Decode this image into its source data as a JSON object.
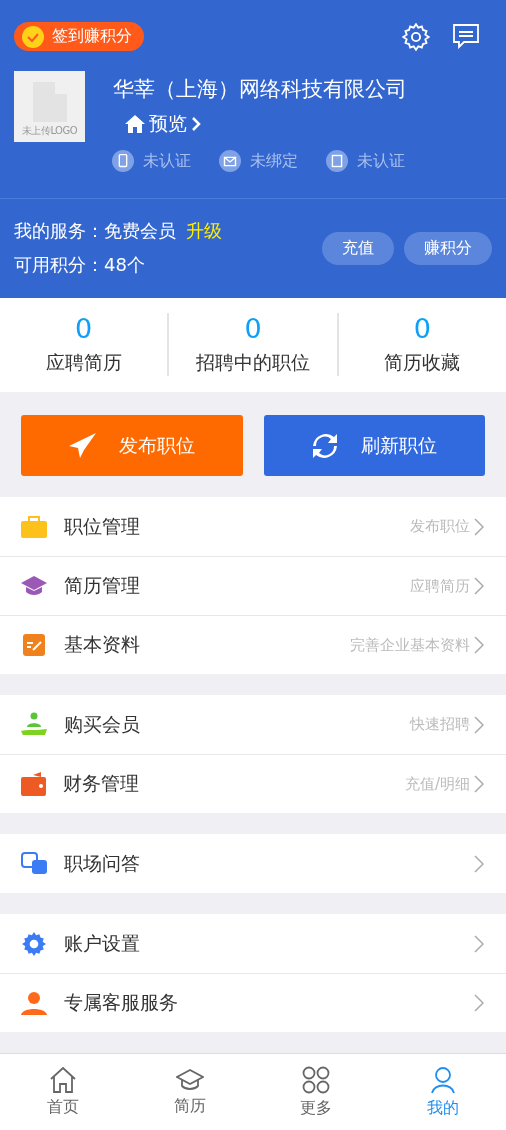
{
  "header": {
    "checkin_badge": "签到赚积分",
    "company_name": "华莘（上海）网络科技有限公司",
    "logo_caption": "未上传LOGO",
    "preview_link": "预览",
    "verifications": [
      {
        "kind": "phone",
        "label": "未认证"
      },
      {
        "kind": "mail",
        "label": "未绑定"
      },
      {
        "kind": "shop",
        "label": "未认证"
      }
    ],
    "service_label": "我的服务：免费会员",
    "upgrade_link": "升级",
    "points_label": "可用积分：48个",
    "buttons": [
      "充值",
      "赚积分"
    ]
  },
  "stats": [
    {
      "value": "0",
      "label": "应聘简历"
    },
    {
      "value": "0",
      "label": "招聘中的职位"
    },
    {
      "value": "0",
      "label": "简历收藏"
    }
  ],
  "actions": [
    {
      "kind": "publish",
      "label": "发布职位"
    },
    {
      "kind": "refresh",
      "label": "刷新职位"
    }
  ],
  "menu_groups": [
    [
      {
        "kind": "briefcase",
        "label": "职位管理",
        "hint": "发布职位"
      },
      {
        "kind": "cap",
        "label": "简历管理",
        "hint": "应聘简历"
      },
      {
        "kind": "edit",
        "label": "基本资料",
        "hint": "完善企业基本资料"
      }
    ],
    [
      {
        "kind": "member",
        "label": "购买会员",
        "hint": "快速招聘"
      },
      {
        "kind": "wallet",
        "label": "财务管理",
        "hint": "充值/明细"
      }
    ],
    [
      {
        "kind": "qa",
        "label": "职场问答"
      }
    ],
    [
      {
        "kind": "gear",
        "label": "账户设置"
      },
      {
        "kind": "agent",
        "label": "专属客服服务"
      }
    ]
  ],
  "tab_bar": [
    {
      "kind": "home",
      "label": "首页",
      "selected": false
    },
    {
      "kind": "cap",
      "label": "简历",
      "selected": false
    },
    {
      "kind": "more",
      "label": "更多",
      "selected": false
    },
    {
      "kind": "user",
      "label": "我的",
      "selected": true
    }
  ]
}
